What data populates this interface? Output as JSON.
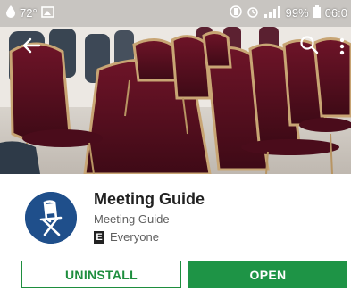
{
  "status_bar": {
    "temperature": "72°",
    "battery_percent": "99%",
    "time": "06:0",
    "icons": [
      "drop-icon",
      "image-icon",
      "vibrate-icon",
      "alarm-icon",
      "signal-icon",
      "battery-icon"
    ]
  },
  "app_bar": {
    "icons": [
      "back-arrow-icon",
      "search-icon",
      "more-vert-icon"
    ]
  },
  "app": {
    "title": "Meeting Guide",
    "developer": "Meeting Guide",
    "content_rating_letter": "E",
    "content_rating": "Everyone",
    "icon": "folding-chair-icon",
    "icon_bg_color": "#1f4f8b"
  },
  "actions": {
    "uninstall_label": "UNINSTALL",
    "open_label": "OPEN"
  },
  "colors": {
    "accent_green": "#1e9446"
  }
}
